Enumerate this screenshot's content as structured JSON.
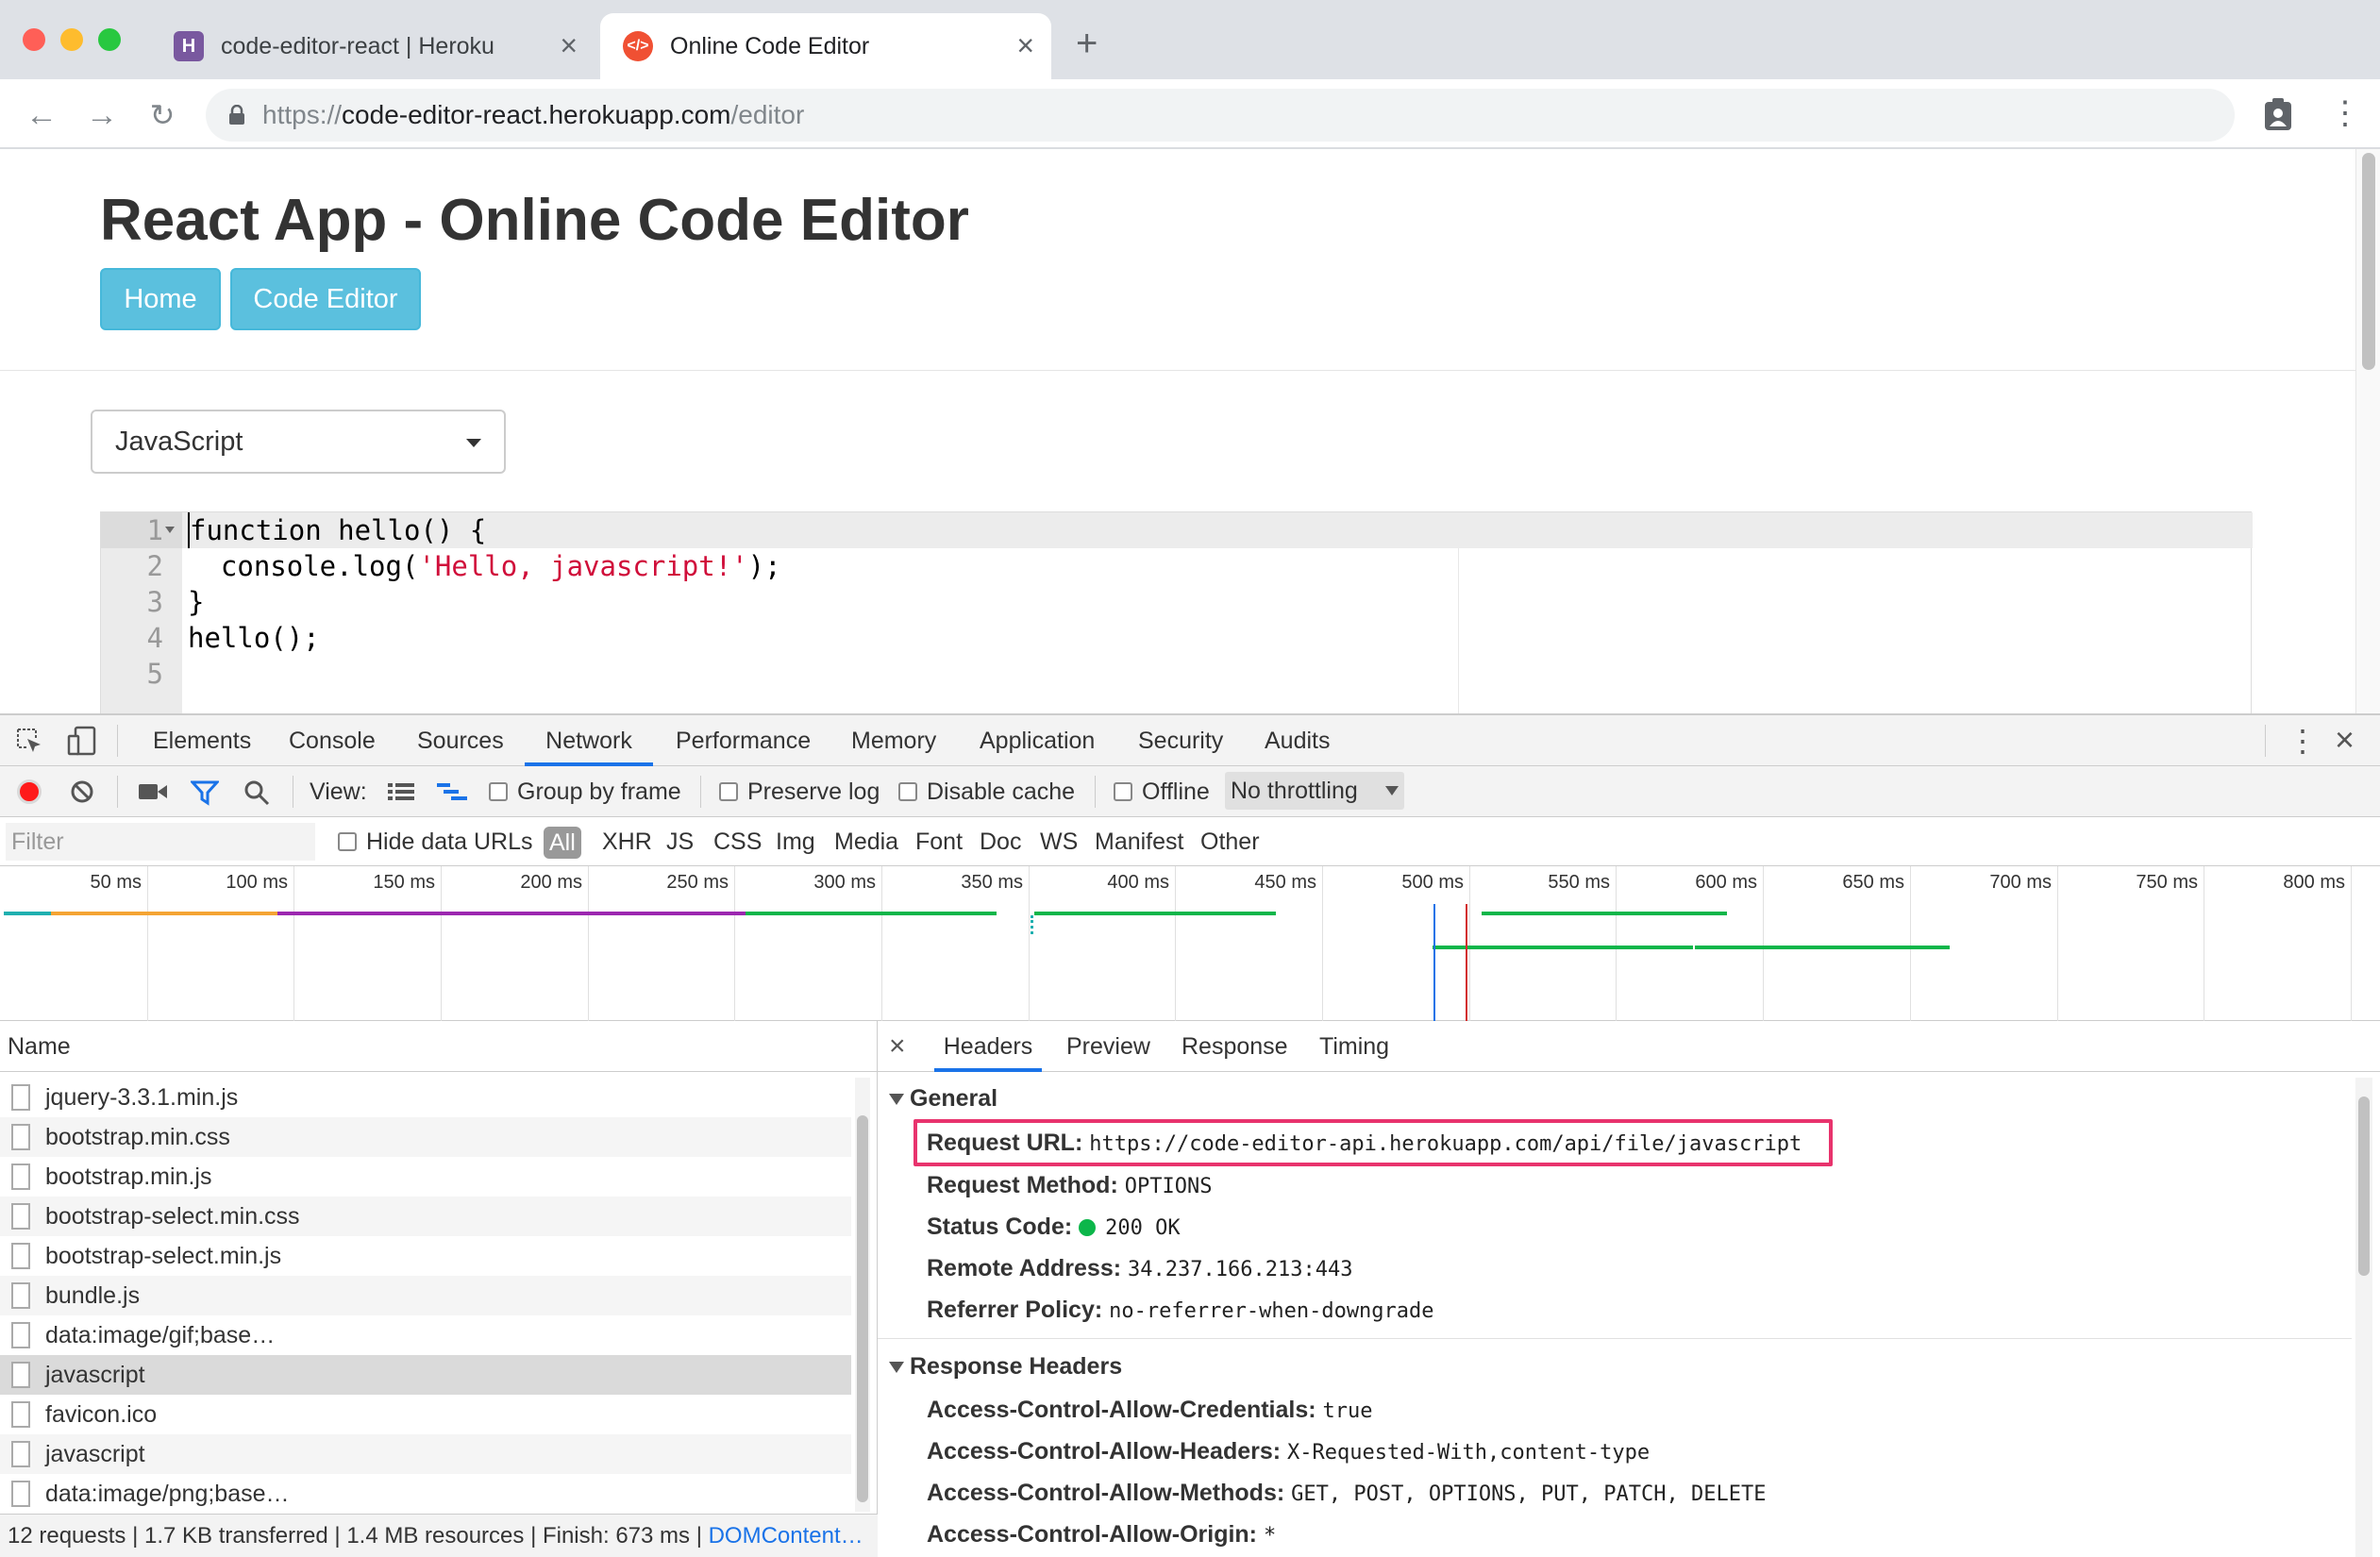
{
  "browser": {
    "tabs": [
      {
        "title": "code-editor-react | Heroku",
        "active": false,
        "favicon": "heroku-icon"
      },
      {
        "title": "Online Code Editor",
        "active": true,
        "favicon": "code-icon"
      }
    ],
    "url": {
      "scheme": "https://",
      "host": "code-editor-react.herokuapp.com",
      "path": "/editor"
    }
  },
  "page": {
    "title": "React App - Online Code Editor",
    "nav": {
      "home": "Home",
      "editor": "Code Editor"
    },
    "language_select": "JavaScript",
    "editor": {
      "line_numbers": [
        "1",
        "2",
        "3",
        "4",
        "5"
      ],
      "lines": [
        {
          "pre": "function hello() {",
          "str": "",
          "post": ""
        },
        {
          "pre": "  console.log(",
          "str": "'Hello, javascript!'",
          "post": ");"
        },
        {
          "pre": "}",
          "str": "",
          "post": ""
        },
        {
          "pre": "hello();",
          "str": "",
          "post": ""
        },
        {
          "pre": "",
          "str": "",
          "post": ""
        }
      ]
    }
  },
  "devtools": {
    "panels": [
      "Elements",
      "Console",
      "Sources",
      "Network",
      "Performance",
      "Memory",
      "Application",
      "Security",
      "Audits"
    ],
    "active_panel": "Network",
    "toolbar": {
      "view_label": "View:",
      "group_by_frame": "Group by frame",
      "preserve_log": "Preserve log",
      "disable_cache": "Disable cache",
      "offline": "Offline",
      "throttling": "No throttling"
    },
    "filter": {
      "placeholder": "Filter",
      "hide_data_urls": "Hide data URLs",
      "types": [
        "All",
        "XHR",
        "JS",
        "CSS",
        "Img",
        "Media",
        "Font",
        "Doc",
        "WS",
        "Manifest",
        "Other"
      ]
    },
    "timeline_ticks": [
      "50 ms",
      "100 ms",
      "150 ms",
      "200 ms",
      "250 ms",
      "300 ms",
      "350 ms",
      "400 ms",
      "450 ms",
      "500 ms",
      "550 ms",
      "600 ms",
      "650 ms",
      "700 ms",
      "750 ms",
      "800 ms"
    ],
    "timeline_colors": {
      "orange": "#f4a433",
      "purple": "#9c27b0",
      "green": "#0cb64a",
      "teal": "#1fb0b0",
      "blue": "#1a73e8",
      "red": "#d32f2f"
    },
    "requests": {
      "column": "Name",
      "items": [
        "jquery-3.3.1.min.js",
        "bootstrap.min.css",
        "bootstrap.min.js",
        "bootstrap-select.min.css",
        "bootstrap-select.min.js",
        "bundle.js",
        "data:image/gif;base…",
        "javascript",
        "favicon.ico",
        "javascript",
        "data:image/png;base…"
      ],
      "selected_index": 7
    },
    "status": {
      "summary": "12 requests | 1.7 KB transferred | 1.4 MB resources | Finish: 673 ms | ",
      "dom_link": "DOMContent…"
    },
    "detail": {
      "tabs": [
        "Headers",
        "Preview",
        "Response",
        "Timing"
      ],
      "active_tab": "Headers",
      "general_title": "General",
      "general": [
        {
          "key": "Request URL:",
          "value": "https://code-editor-api.herokuapp.com/api/file/javascript"
        },
        {
          "key": "Request Method:",
          "value": "OPTIONS"
        },
        {
          "key": "Status Code:",
          "value": "200 OK"
        },
        {
          "key": "Remote Address:",
          "value": "34.237.166.213:443"
        },
        {
          "key": "Referrer Policy:",
          "value": "no-referrer-when-downgrade"
        }
      ],
      "response_title": "Response Headers",
      "response_headers": [
        {
          "key": "Access-Control-Allow-Credentials:",
          "value": "true"
        },
        {
          "key": "Access-Control-Allow-Headers:",
          "value": "X-Requested-With,content-type"
        },
        {
          "key": "Access-Control-Allow-Methods:",
          "value": "GET, POST, OPTIONS, PUT, PATCH, DELETE"
        },
        {
          "key": "Access-Control-Allow-Origin:",
          "value": "*"
        }
      ]
    }
  }
}
